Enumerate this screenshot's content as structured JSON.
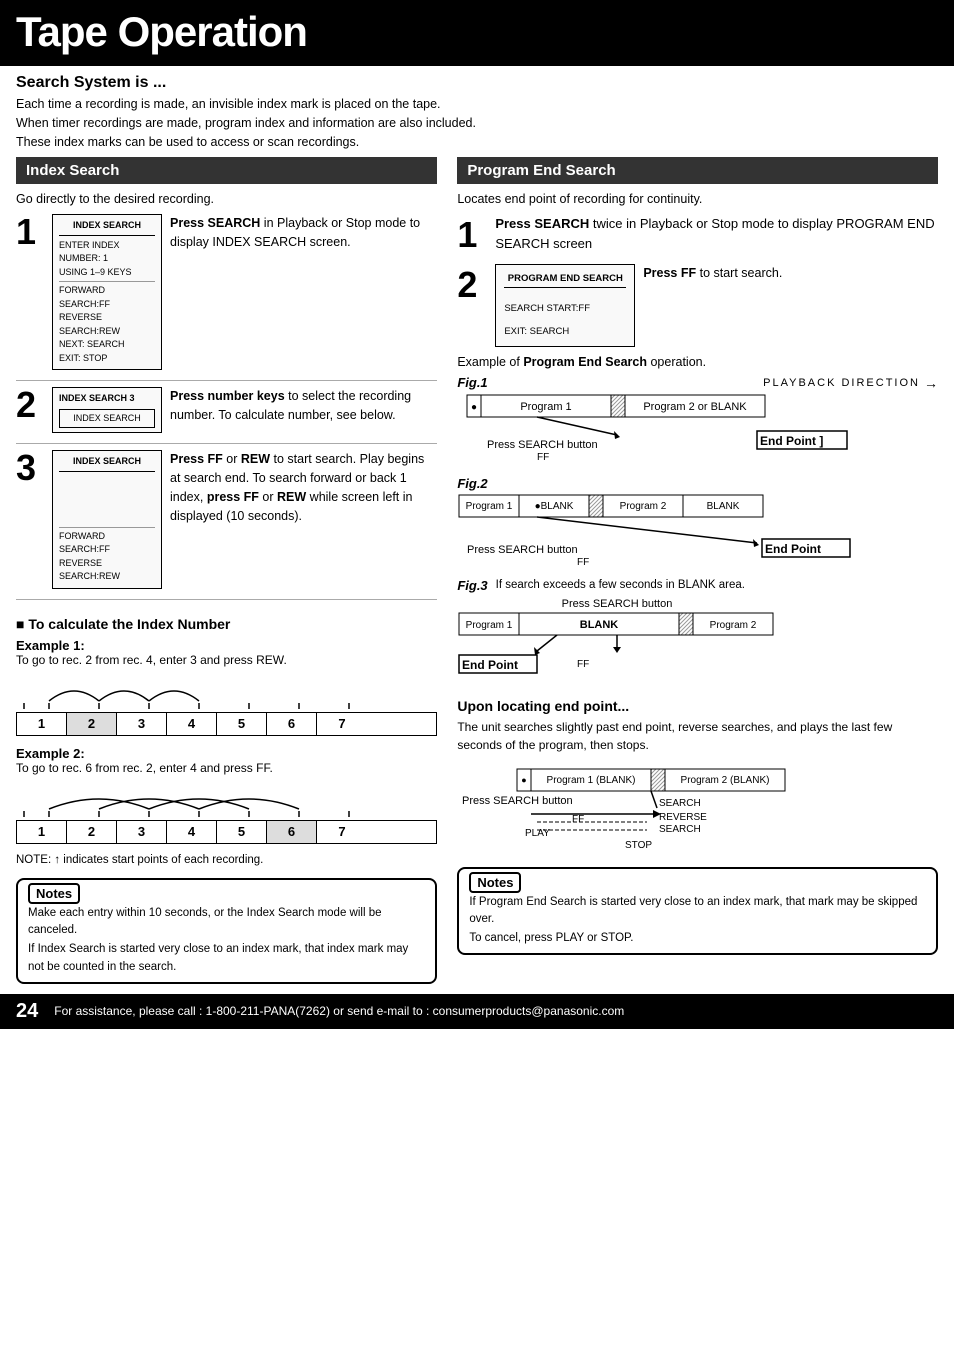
{
  "page": {
    "title": "Tape Operation"
  },
  "search_system": {
    "heading": "Search System is ...",
    "lines": [
      "Each time a recording is made, an invisible index mark is placed on the tape.",
      "When timer recordings are made, program index and information are also included.",
      "These index marks can be used to access or scan recordings."
    ]
  },
  "index_search": {
    "section_title": "Index Search",
    "intro": "Go directly to the desired recording.",
    "steps": [
      {
        "num": "1",
        "box_title": "INDEX SEARCH",
        "box_lines": [
          "ENTER INDEX NUMBER: 1",
          "USING 1–9 KEYS",
          "",
          "FORWARD SEARCH:FF",
          "REVERSE SEARCH:REW",
          "NEXT: SEARCH",
          "EXIT: STOP"
        ],
        "text_html": "<strong>Press SEARCH</strong> in Playback or Stop mode to display INDEX SEARCH screen."
      },
      {
        "num": "2",
        "box_title": "INDEX SEARCH 3",
        "box_subtitle": "INDEX SEARCH",
        "text_html": "<strong>Press number keys</strong> to select the recording number. To calculate number, see below."
      },
      {
        "num": "3",
        "box_title": "INDEX SEARCH",
        "box_lines": [
          "",
          "",
          "",
          "",
          "FORWARD SEARCH:FF",
          "REVERSE SEARCH:REW"
        ],
        "text_html": "<strong>Press FF</strong> or <strong>REW</strong> to start search. Play begins at search end. To search forward or back 1 index, <strong>press FF</strong> or <strong>REW</strong> while screen left in displayed (10 seconds)."
      }
    ]
  },
  "index_calc": {
    "heading": "■ To calculate the Index Number",
    "example1_label": "Example 1:",
    "example1_text": "To go to rec. 2 from rec. 4, enter 3 and press REW.",
    "example2_label": "Example 2:",
    "example2_text": "To go to rec. 6 from rec. 2, enter 4 and press FF.",
    "note": "NOTE: ↑ indicates start points of each recording.",
    "number_cells": [
      "1",
      "2",
      "3",
      "4",
      "5",
      "6",
      "7"
    ],
    "highlight_cells_ex1": [
      1,
      2
    ],
    "highlight_cells_ex2": [
      1,
      2,
      3,
      4,
      5
    ]
  },
  "index_notes": {
    "title": "Notes",
    "lines": [
      "Make each entry within 10 seconds, or the Index Search mode will be canceled.",
      "If Index Search is started very close to an index mark, that index mark may not be counted in the search."
    ]
  },
  "program_end_search": {
    "section_title": "Program End Search",
    "intro": "Locates end point of recording for continuity.",
    "step1_text": "Press SEARCH twice in Playback or Stop mode to display PROGRAM END SEARCH screen",
    "step2_box_title": "PROGRAM END SEARCH",
    "step2_box_lines": [
      "",
      "SEARCH START:FF",
      "",
      "EXIT: SEARCH"
    ],
    "step2_text": "Press FF to start search.",
    "fig_example_label": "Example of",
    "fig_example_bold": "Program End Search",
    "fig_example_end": "operation.",
    "fig1_label": "Fig.1",
    "fig1_direction": "PLAYBACK DIRECTION",
    "fig1_seg1": "Program 1",
    "fig1_seg2": "Program 2 or BLANK",
    "fig1_label_search": "Press SEARCH button",
    "fig1_label_ff": "FF",
    "fig1_end_point": "End Point ]",
    "fig2_label": "Fig.2",
    "fig2_seg1": "Program 1",
    "fig2_seg2": "●BLANK",
    "fig2_seg3": "Program 2",
    "fig2_seg4": "BLANK",
    "fig2_label_search": "Press SEARCH button",
    "fig2_label_ff": "FF",
    "fig2_end_point": "End Point",
    "fig3_label": "Fig.3",
    "fig3_text": "If search exceeds a few seconds in BLANK area.",
    "fig3_search_label": "Press SEARCH button",
    "fig3_seg1": "Program 1",
    "fig3_seg2": "BLANK",
    "fig3_seg3": "Program 2",
    "fig3_label_ff": "FF",
    "fig3_end_point": "End Point",
    "upon_heading": "Upon locating end point...",
    "upon_text": "The unit searches slightly past end point, reverse searches, and plays the last few seconds of the program, then stops.",
    "upon_seg1": "Program 1 (BLANK)",
    "upon_seg2": "Program 2 (BLANK)",
    "upon_search_label": "Press SEARCH button",
    "upon_search_text": "SEARCH",
    "upon_ff": "FF",
    "upon_play": "PLAY",
    "upon_reverse": "REVERSE SEARCH",
    "upon_stop": "STOP"
  },
  "pes_notes": {
    "title": "Notes",
    "lines": [
      "If Program End Search is started very close to an index mark, that mark may be skipped over.",
      "To cancel, press PLAY or STOP."
    ]
  },
  "footer": {
    "page_num": "24",
    "text": "For assistance, please call : 1-800-211-PANA(7262) or send e-mail to : consumerproducts@panasonic.com"
  }
}
